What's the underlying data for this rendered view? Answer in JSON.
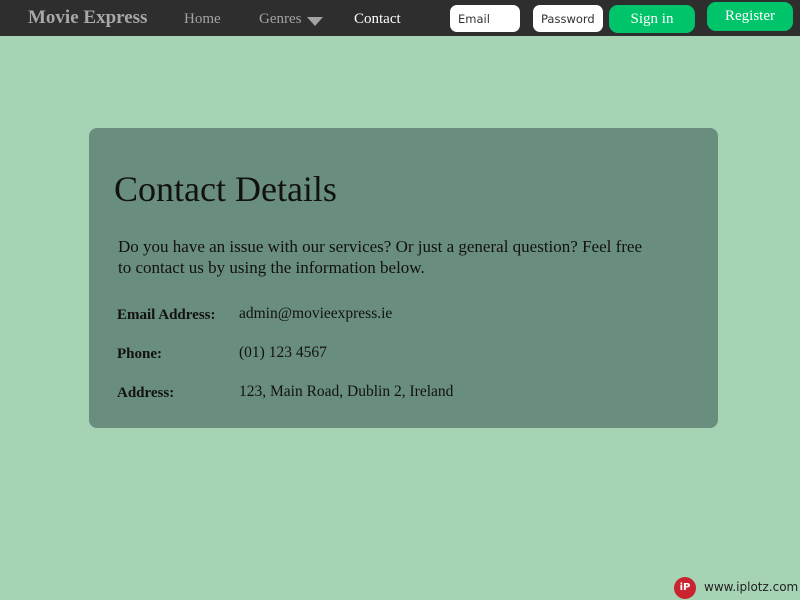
{
  "navbar": {
    "brand": "Movie Express",
    "links": {
      "home": "Home",
      "genres": "Genres",
      "contact": "Contact"
    },
    "genres_icon": "chevron-down-icon",
    "email_placeholder": "Email",
    "password_placeholder": "Password",
    "signin_label": "Sign in",
    "register_label": "Register"
  },
  "contact": {
    "title": "Contact Details",
    "intro": "Do you have an issue with our services? Or just a general question? Feel free to contact us by using the information below.",
    "rows": [
      {
        "label": "Email Address:",
        "value": "admin@movieexpress.ie"
      },
      {
        "label": "Phone:",
        "value": "(01) 123 4567"
      },
      {
        "label": "Address:",
        "value": "123, Main Road, Dublin 2, Ireland"
      }
    ]
  },
  "watermark": {
    "logo_text": "iP",
    "text": "www.iplotz.com"
  },
  "colors": {
    "page_background": "#a7d3b5",
    "navbar_background": "#2e2e2e",
    "card_background": "#6a8e7e",
    "button_green": "#00c46a",
    "active_link": "#ffffff",
    "inactive_link": "#a3a3a3"
  }
}
